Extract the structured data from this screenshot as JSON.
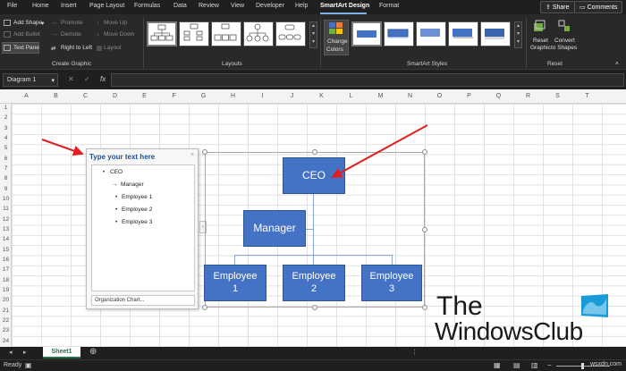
{
  "tabs": [
    "File",
    "Home",
    "Insert",
    "Page Layout",
    "Formulas",
    "Data",
    "Review",
    "View",
    "Developer",
    "Help",
    "SmartArt Design",
    "Format"
  ],
  "active_tab": "SmartArt Design",
  "top_buttons": {
    "share": "Share",
    "comments": "Comments"
  },
  "create_graphic": {
    "add_shape": "Add Shape",
    "add_bullet": "Add Bullet",
    "text_pane": "Text Pane",
    "promote": "Promote",
    "demote": "Demote",
    "right_to_left": "Right to Left",
    "move_up": "Move Up",
    "move_down": "Move Down",
    "layout": "Layout",
    "group_label": "Create Graphic"
  },
  "layouts": {
    "group_label": "Layouts"
  },
  "smartart_styles": {
    "change_colors_1": "Change",
    "change_colors_2": "Colors",
    "group_label": "SmartArt Styles"
  },
  "reset": {
    "reset_graphic_1": "Reset",
    "reset_graphic_2": "Graphic",
    "convert_1": "Convert",
    "convert_2": "to Shapes",
    "group_label": "Reset"
  },
  "formula_bar": {
    "name_box": "Diagram 1",
    "fx": "fx"
  },
  "columns": [
    "A",
    "B",
    "C",
    "D",
    "E",
    "F",
    "G",
    "H",
    "I",
    "J",
    "K",
    "L",
    "M",
    "N",
    "O",
    "P",
    "Q",
    "R",
    "S",
    "T"
  ],
  "rows": [
    "1",
    "2",
    "3",
    "4",
    "5",
    "6",
    "7",
    "8",
    "9",
    "10",
    "11",
    "12",
    "13",
    "14",
    "15",
    "16",
    "17",
    "18",
    "19",
    "20",
    "21",
    "22",
    "23",
    "24"
  ],
  "text_pane": {
    "title": "Type your text here",
    "close": "×",
    "items": [
      {
        "bullet": "•",
        "text": "CEO"
      },
      {
        "bullet": "→",
        "text": "Manager"
      },
      {
        "bullet": "•",
        "text": "Employee 1"
      },
      {
        "bullet": "•",
        "text": "Employee 2"
      },
      {
        "bullet": "•",
        "text": "Employee 3"
      }
    ],
    "footer": "Organization Chart..."
  },
  "org_chart": {
    "ceo": "CEO",
    "manager": "Manager",
    "employee1_l1": "Employee",
    "employee1_l2": "1",
    "employee2_l1": "Employee",
    "employee2_l2": "2",
    "employee3_l1": "Employee",
    "employee3_l2": "3",
    "box_color": "#4472c4"
  },
  "sheet_tab": "Sheet1",
  "status": {
    "ready": "Ready"
  },
  "watermark": {
    "line1": "The",
    "line2": "WindowsClub",
    "small": "wsxdn.com"
  },
  "colors": {
    "accent": "#7fb2e5",
    "arrow": "#e02020",
    "excel_green": "#217346"
  }
}
